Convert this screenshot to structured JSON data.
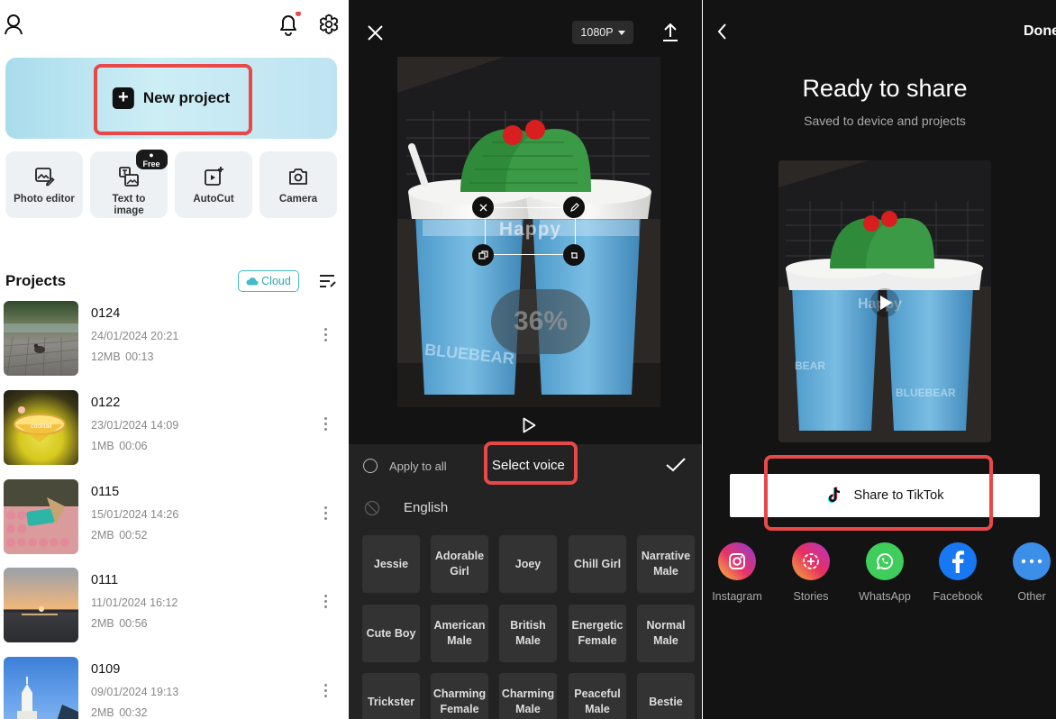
{
  "home": {
    "new_project_label": "New project",
    "tools": [
      {
        "label": "Photo editor"
      },
      {
        "label": "Text to image",
        "badge": "Free"
      },
      {
        "label": "AutoCut"
      },
      {
        "label": "Camera"
      }
    ],
    "projects_title": "Projects",
    "cloud_label": "Cloud",
    "projects": [
      {
        "name": "0124",
        "date": "24/01/2024 20:21",
        "size": "12MB",
        "duration": "00:13"
      },
      {
        "name": "0122",
        "date": "23/01/2024 14:09",
        "size": "1MB",
        "duration": "00:06"
      },
      {
        "name": "0115",
        "date": "15/01/2024 14:26",
        "size": "2MB",
        "duration": "00:52"
      },
      {
        "name": "0111",
        "date": "11/01/2024 16:12",
        "size": "2MB",
        "duration": "00:56"
      },
      {
        "name": "0109",
        "date": "09/01/2024 19:13",
        "size": "2MB",
        "duration": "00:32"
      }
    ],
    "thumb_text": "cocktail"
  },
  "editor": {
    "resolution": "1080P",
    "overlay_text": "Happy",
    "progress": "36%",
    "cup_text": "BLUEBEAR",
    "apply_all": "Apply to all",
    "select_voice": "Select voice",
    "language": "English",
    "voices": [
      [
        "Jessie",
        "Adorable Girl",
        "Joey",
        "Chill Girl",
        "Narrative Male"
      ],
      [
        "Cute Boy",
        "American Male",
        "British Male",
        "Energetic Female",
        "Normal Male"
      ],
      [
        "Trickster",
        "Charming Female",
        "Charming Male",
        "Peaceful Male",
        "Bestie"
      ]
    ]
  },
  "share": {
    "done": "Done",
    "title": "Ready to share",
    "subtitle": "Saved to device and projects",
    "tiktok_label": "Share to TikTok",
    "targets": [
      "Instagram",
      "Stories",
      "WhatsApp",
      "Facebook",
      "Other"
    ]
  },
  "colors": {
    "highlight": "#e84848",
    "panel_dark": "#131313",
    "sheet": "#232323"
  }
}
